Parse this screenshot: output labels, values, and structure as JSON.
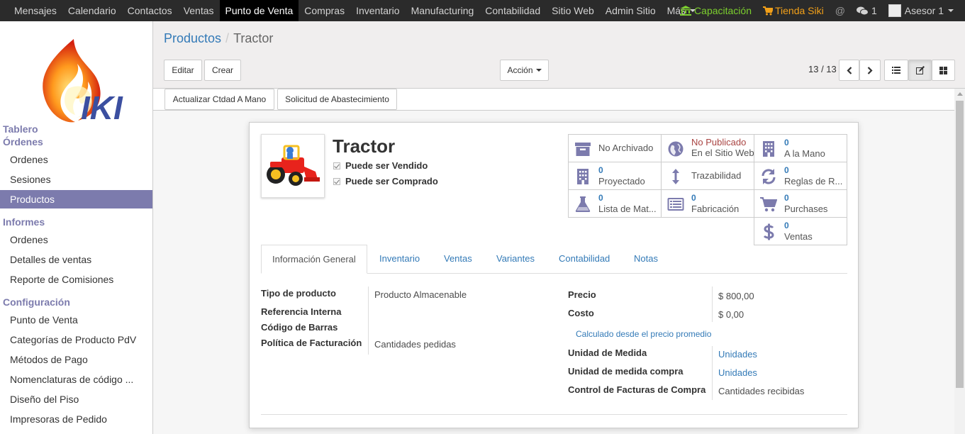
{
  "topbar": {
    "menu": [
      "Mensajes",
      "Calendario",
      "Contactos",
      "Ventas",
      "Punto de Venta",
      "Compras",
      "Inventario",
      "Manufacturing",
      "Contabilidad",
      "Sitio Web",
      "Admin Sitio",
      "Más"
    ],
    "active_menu": "Punto de Venta",
    "capacitacion": "Capacitación",
    "tienda": "Tienda Siki",
    "messages_count": "1",
    "user": "Asesor 1",
    "colors": {
      "capacitacion": "#7ccf2e",
      "tienda": "#f2a019"
    }
  },
  "sidebar": {
    "logo_text": "IKI",
    "sections": [
      {
        "title": "Tablero",
        "items": []
      },
      {
        "title": "Órdenes",
        "items": [
          "Ordenes",
          "Sesiones",
          "Productos"
        ]
      },
      {
        "title": "Informes",
        "items": [
          "Ordenes",
          "Detalles de ventas",
          "Reporte de Comisiones"
        ]
      },
      {
        "title": "Configuración",
        "items": [
          "Punto de Venta",
          "Categorías de Producto PdV",
          "Métodos de Pago",
          "Nomenclaturas de código ...",
          "Diseño del Piso",
          "Impresoras de Pedido"
        ]
      }
    ],
    "active_item": "Productos",
    "accent": "#7c7bad"
  },
  "control_panel": {
    "breadcrumb": [
      "Productos",
      "Tractor"
    ],
    "edit_label": "Editar",
    "create_label": "Crear",
    "action_label": "Acción",
    "pager": "13 / 13"
  },
  "statusbar": {
    "buttons": [
      "Actualizar Ctdad A Mano",
      "Solicitud de Abastecimiento"
    ]
  },
  "product": {
    "name": "Tractor",
    "can_be_sold": "Puede ser Vendido",
    "can_be_purchased": "Puede ser Comprado"
  },
  "smart_buttons": [
    {
      "name": "archive",
      "value": "",
      "label": "No Archivado",
      "icon": "archive-icon"
    },
    {
      "name": "website",
      "value": "No Publicado",
      "label": "En el Sitio Web",
      "icon": "globe-icon"
    },
    {
      "name": "on-hand",
      "value": "0",
      "label": "A la Mano",
      "icon": "building-icon"
    },
    {
      "name": "forecast",
      "value": "0",
      "label": "Proyectado",
      "icon": "building-icon"
    },
    {
      "name": "traceability",
      "value": "",
      "label": "Trazabilidad",
      "icon": "arrows-v-icon"
    },
    {
      "name": "reordering",
      "value": "0",
      "label": "Reglas de R...",
      "icon": "refresh-icon"
    },
    {
      "name": "bom",
      "value": "0",
      "label": "Lista de Mat...",
      "icon": "flask-icon"
    },
    {
      "name": "manufacturing",
      "value": "0",
      "label": "Fabricación",
      "icon": "list-alt-icon"
    },
    {
      "name": "purchases",
      "value": "0",
      "label": "Purchases",
      "icon": "shopping-cart-icon"
    },
    {
      "name": "sales",
      "value": "0",
      "label": "Ventas",
      "icon": "dollar-icon"
    }
  ],
  "tabs": [
    "Información General",
    "Inventario",
    "Ventas",
    "Variantes",
    "Contabilidad",
    "Notas"
  ],
  "active_tab": "Información General",
  "general": {
    "left": [
      {
        "label": "Tipo de producto",
        "value": "Producto Almacenable"
      },
      {
        "label": "Referencia Interna",
        "value": ""
      },
      {
        "label": "Código de Barras",
        "value": ""
      },
      {
        "label": "Política de Facturación",
        "value": "Cantidades pedidas"
      }
    ],
    "right": [
      {
        "label": "Precio",
        "value": "$ 800,00"
      },
      {
        "label": "Costo",
        "value": "$ 0,00"
      },
      {
        "label": "",
        "value": "Calculado desde el precio promedio"
      },
      {
        "label": "Unidad de Medida",
        "value": "Unidades"
      },
      {
        "label": "Unidad de medida compra",
        "value": "Unidades"
      },
      {
        "label": "Control de Facturas de Compra",
        "value": "Cantidades recibidas"
      }
    ]
  }
}
